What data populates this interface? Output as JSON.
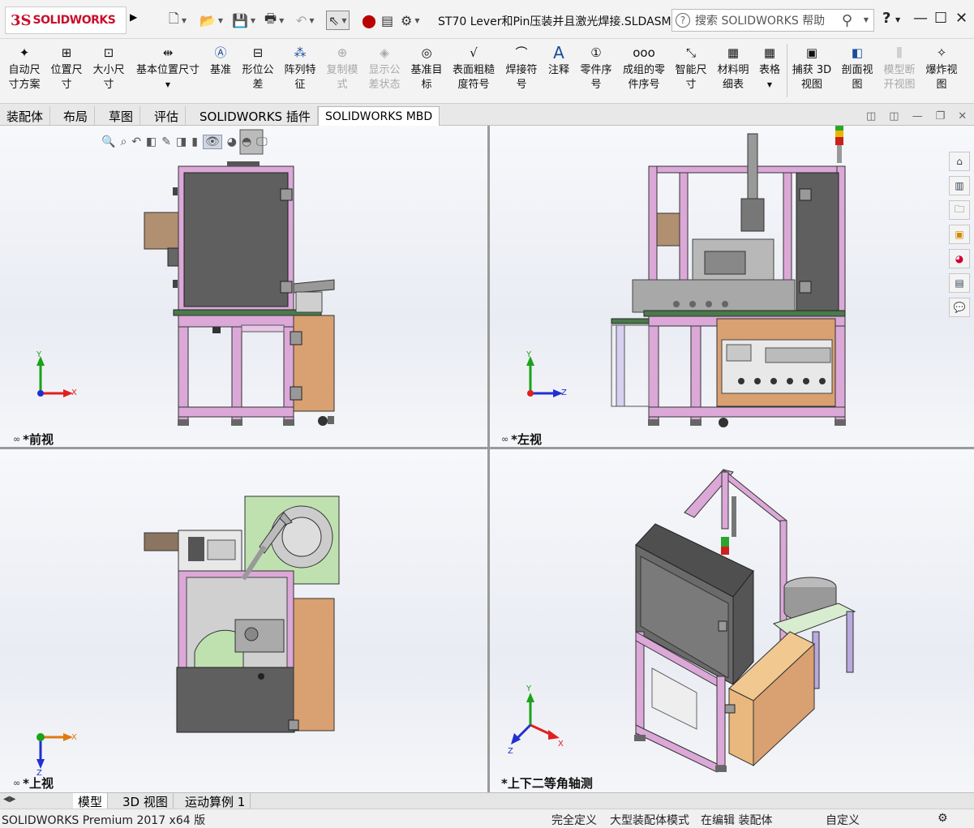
{
  "app": {
    "logo_mark": "3S",
    "logo_text": "SOLIDWORKS",
    "doc_title": "ST70 Lever和Pin压装并且激光焊接.SLDASM *",
    "search_placeholder": "搜索 SOLIDWORKS 帮助",
    "help_label": "?",
    "quick_access": [
      {
        "icon": "new-document-icon"
      },
      {
        "icon": "open-folder-icon"
      },
      {
        "icon": "save-icon"
      },
      {
        "icon": "print-icon"
      },
      {
        "icon": "undo-icon"
      },
      {
        "icon": "select-pointer-icon"
      },
      {
        "icon": "traffic-light-icon"
      },
      {
        "icon": "file-properties-icon"
      },
      {
        "icon": "options-gear-icon"
      }
    ]
  },
  "toolbar": [
    {
      "label": "自动尺\n寸方案",
      "icon": "auto-dimension-icon",
      "enabled": true
    },
    {
      "label": "位置尺\n寸",
      "icon": "location-dimension-icon",
      "enabled": true
    },
    {
      "label": "大小尺\n寸",
      "icon": "size-dimension-icon",
      "enabled": true
    },
    {
      "label": "基本位置尺寸",
      "icon": "basic-location-dimension-icon",
      "enabled": true
    },
    {
      "label": "基准",
      "icon": "datum-icon",
      "enabled": true
    },
    {
      "label": "形位公\n差",
      "icon": "geometric-tolerance-icon",
      "enabled": true
    },
    {
      "label": "阵列特\n征",
      "icon": "pattern-feature-icon",
      "enabled": true
    },
    {
      "label": "复制模\n式",
      "icon": "copy-scheme-icon",
      "enabled": false
    },
    {
      "label": "显示公\n差状态",
      "icon": "show-tolerance-status-icon",
      "enabled": false
    },
    {
      "label": "基准目\n标",
      "icon": "datum-target-icon",
      "enabled": true
    },
    {
      "label": "表面粗糙\n度符号",
      "icon": "surface-finish-icon",
      "enabled": true
    },
    {
      "label": "焊接符\n号",
      "icon": "weld-symbol-icon",
      "enabled": true
    },
    {
      "label": "注释",
      "icon": "note-icon",
      "enabled": true
    },
    {
      "label": "零件序\n号",
      "icon": "balloon-icon",
      "enabled": true
    },
    {
      "label": "成组的零\n件序号",
      "icon": "stacked-balloon-icon",
      "enabled": true
    },
    {
      "label": "智能尺\n寸",
      "icon": "smart-dimension-icon",
      "enabled": true
    },
    {
      "label": "材料明\n细表",
      "icon": "bill-of-materials-icon",
      "enabled": true
    },
    {
      "label": "表格",
      "icon": "table-icon",
      "enabled": true
    },
    {
      "label": "捕获 3D\n视图",
      "icon": "capture-3d-view-icon",
      "enabled": true
    },
    {
      "label": "剖面视\n图",
      "icon": "section-view-icon",
      "enabled": true
    },
    {
      "label": "模型断\n开视图",
      "icon": "model-break-view-icon",
      "enabled": false
    },
    {
      "label": "爆炸视\n图",
      "icon": "exploded-view-icon",
      "enabled": true
    }
  ],
  "tabs": [
    {
      "label": "装配体",
      "active": false
    },
    {
      "label": "布局",
      "active": false
    },
    {
      "label": "草图",
      "active": false
    },
    {
      "label": "评估",
      "active": false
    },
    {
      "label": "SOLIDWORKS 插件",
      "active": false
    },
    {
      "label": "SOLIDWORKS MBD",
      "active": true
    }
  ],
  "viewports": [
    {
      "label": "*前视",
      "axes": [
        "Y",
        "X"
      ]
    },
    {
      "label": "*左视",
      "axes": [
        "Y",
        "Z"
      ]
    },
    {
      "label": "*上视",
      "axes": [
        "X",
        "Z"
      ]
    },
    {
      "label": "*上下二等角轴测",
      "axes": [
        "Y",
        "X",
        "Z"
      ]
    }
  ],
  "task_pane": [
    {
      "icon": "home-icon"
    },
    {
      "icon": "design-library-icon"
    },
    {
      "icon": "file-explorer-icon"
    },
    {
      "icon": "view-palette-icon"
    },
    {
      "icon": "appearances-icon"
    },
    {
      "icon": "custom-properties-icon"
    },
    {
      "icon": "forum-icon"
    }
  ],
  "bottom_tabs": [
    {
      "label": "模型",
      "active": true
    },
    {
      "label": "3D 视图",
      "active": false
    },
    {
      "label": "运动算例 1",
      "active": false
    }
  ],
  "status": {
    "product": "SOLIDWORKS Premium 2017 x64 版",
    "definition": "完全定义",
    "mode": "大型装配体模式",
    "editing": "在编辑 装配体",
    "units": "自定义"
  },
  "colors": {
    "frame_pink": "#d9a7d6",
    "enclosure_gray": "#5f5f5f",
    "cabinet_tan": "#d9a071",
    "plate_green": "#bfe1b0",
    "axis_red": "#e02020",
    "axis_green": "#19a319",
    "axis_blue": "#2030d0",
    "axis_orange": "#e07a10",
    "brand_red": "#c8102e"
  }
}
